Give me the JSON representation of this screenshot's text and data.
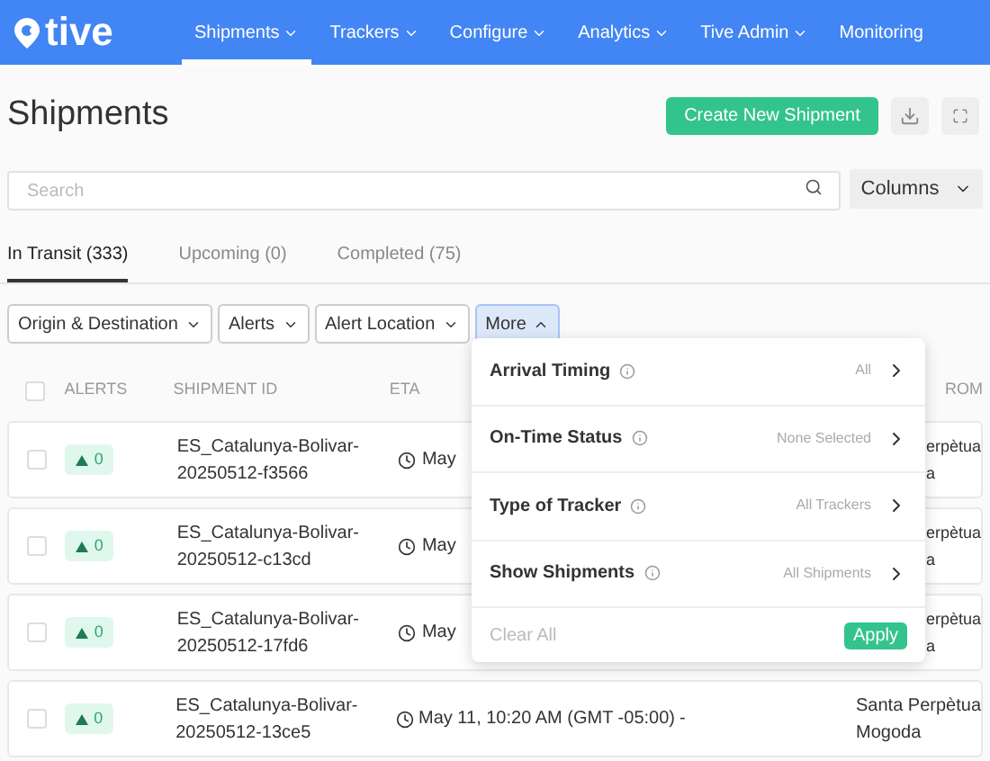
{
  "nav": {
    "logo": "tive",
    "items": [
      {
        "label": "Shipments",
        "dropdown": true,
        "selected": true
      },
      {
        "label": "Trackers",
        "dropdown": true,
        "selected": false
      },
      {
        "label": "Configure",
        "dropdown": true,
        "selected": false
      },
      {
        "label": "Analytics",
        "dropdown": true,
        "selected": false
      },
      {
        "label": "Tive Admin",
        "dropdown": true,
        "selected": false
      },
      {
        "label": "Monitoring",
        "dropdown": false,
        "selected": false
      }
    ]
  },
  "page": {
    "title": "Shipments",
    "create_button": "Create New Shipment"
  },
  "search": {
    "placeholder": "Search"
  },
  "columns_button": "Columns",
  "tabs": [
    {
      "label": "In Transit (333)",
      "selected": true
    },
    {
      "label": "Upcoming (0)",
      "selected": false
    },
    {
      "label": "Completed (75)",
      "selected": false
    }
  ],
  "filters": [
    {
      "label": "Origin & Destination",
      "open": false
    },
    {
      "label": "Alerts",
      "open": false
    },
    {
      "label": "Alert Location",
      "open": false
    },
    {
      "label": "More",
      "open": true
    }
  ],
  "table": {
    "select_all_checked": false,
    "columns": [
      "ALERTS",
      "SHIPMENT ID",
      "ETA",
      "ROM"
    ],
    "rows": [
      {
        "checked": false,
        "alerts": "0",
        "id": [
          "ES_Catalunya-Bolivar-",
          "20250512-f3566"
        ],
        "eta": "May",
        "from": [
          "erpètua",
          "a"
        ],
        "covered": true
      },
      {
        "checked": false,
        "alerts": "0",
        "id": [
          "ES_Catalunya-Bolivar-",
          "20250512-c13cd"
        ],
        "eta": "May",
        "from": [
          "erpètua",
          "a"
        ],
        "covered": true
      },
      {
        "checked": false,
        "alerts": "0",
        "id": [
          "ES_Catalunya-Bolivar-",
          "20250512-17fd6"
        ],
        "eta": "May",
        "from": [
          "erpètua",
          "a"
        ],
        "covered": true
      },
      {
        "checked": false,
        "alerts": "0",
        "id": [
          "ES_Catalunya-Bolivar-",
          "20250512-13ce5"
        ],
        "eta": "May 11, 10:20 AM (GMT -05:00)",
        "column_5": "-",
        "from": [
          "Santa Perpètua",
          "Mogoda"
        ],
        "covered": false
      }
    ]
  },
  "more_menu": {
    "options": [
      {
        "label": "Arrival Timing",
        "value": "All"
      },
      {
        "label": "On-Time Status",
        "value": "None Selected"
      },
      {
        "label": "Type of Tracker",
        "value": "All Trackers"
      },
      {
        "label": "Show Shipments",
        "value": "All Shipments"
      }
    ],
    "clear": "Clear All",
    "apply": "Apply"
  }
}
